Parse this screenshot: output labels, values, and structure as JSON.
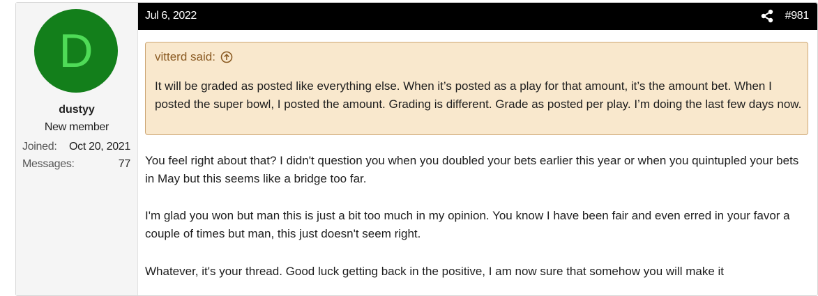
{
  "user": {
    "avatar_letter": "D",
    "username": "dustyy",
    "title": "New member",
    "joined_label": "Joined:",
    "joined_value": "Oct 20, 2021",
    "messages_label": "Messages:",
    "messages_value": "77",
    "avatar_color": "#137f1b",
    "avatar_letter_color": "#4fdb57"
  },
  "header": {
    "date": "Jul 6, 2022",
    "post_number": "#981",
    "share_icon": "share-icon"
  },
  "quote": {
    "author": "vitterd said:",
    "text": "It will be graded as posted like everything else. When it’s posted as a play for that amount, it’s the amount bet. When I posted the super bowl, I posted the amount. Grading is different. Grade as posted per play. I’m doing the last few days now."
  },
  "body": {
    "paragraphs": [
      "You feel right about that? I didn't question you when you doubled your bets earlier this year or when you quintupled your bets in May but this seems like a bridge too far.",
      "I'm glad you won but man this is just a bit too much in my opinion. You know I have been fair and even erred in your favor a couple of times but man, this just doesn't seem right.",
      "Whatever, it's your thread. Good luck getting back in the positive, I am now sure that somehow you will make it"
    ]
  }
}
